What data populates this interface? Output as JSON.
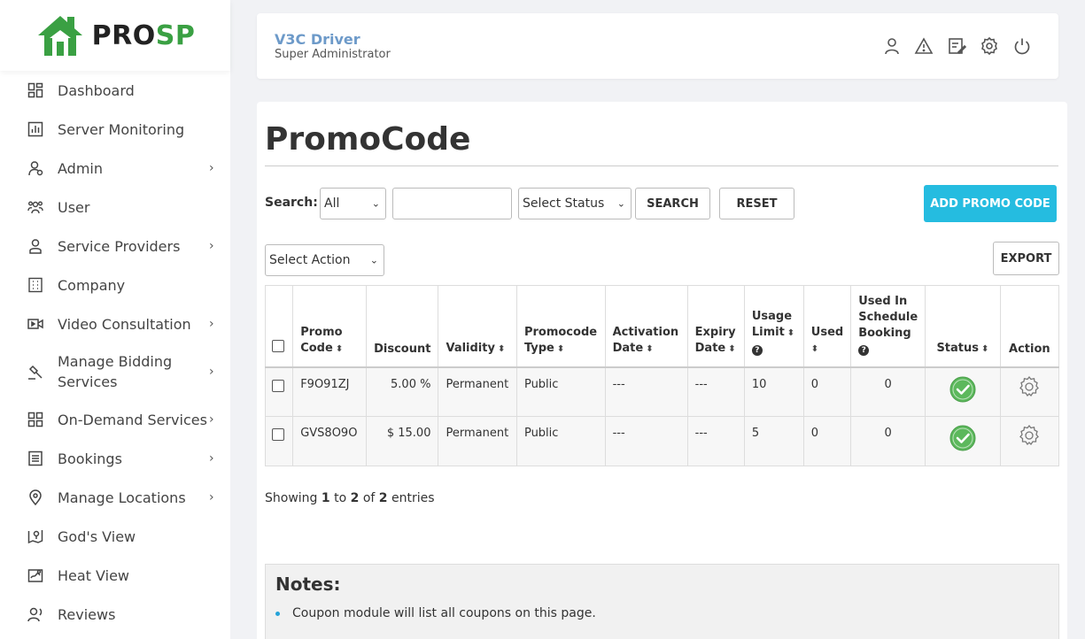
{
  "brand": {
    "logo_pro": "PRO",
    "logo_sp": "SP"
  },
  "sidebar": {
    "items": [
      {
        "label": "Dashboard",
        "icon": "dashboard-icon",
        "has_submenu": false
      },
      {
        "label": "Server Monitoring",
        "icon": "chart-icon",
        "has_submenu": false
      },
      {
        "label": "Admin",
        "icon": "admin-icon",
        "has_submenu": true
      },
      {
        "label": "User",
        "icon": "users-icon",
        "has_submenu": false
      },
      {
        "label": "Service Providers",
        "icon": "provider-icon",
        "has_submenu": true
      },
      {
        "label": "Company",
        "icon": "building-icon",
        "has_submenu": false
      },
      {
        "label": "Video Consultation",
        "icon": "video-icon",
        "has_submenu": true
      },
      {
        "label": "Manage Bidding Services",
        "icon": "gavel-icon",
        "has_submenu": true
      },
      {
        "label": "On-Demand Services",
        "icon": "grid-icon",
        "has_submenu": true
      },
      {
        "label": "Bookings",
        "icon": "list-icon",
        "has_submenu": true
      },
      {
        "label": "Manage Locations",
        "icon": "location-icon",
        "has_submenu": true
      },
      {
        "label": "God's View",
        "icon": "map-icon",
        "has_submenu": false
      },
      {
        "label": "Heat View",
        "icon": "heatmap-icon",
        "has_submenu": false
      },
      {
        "label": "Reviews",
        "icon": "review-icon",
        "has_submenu": false
      }
    ]
  },
  "header": {
    "user_name": "V3C Driver",
    "user_role": "Super Administrator",
    "icons": [
      "profile-icon",
      "alert-icon",
      "edit-note-icon",
      "settings-icon",
      "power-icon"
    ]
  },
  "page": {
    "title": "PromoCode",
    "search_label": "Search:",
    "search_field_select": "All",
    "search_input_value": "",
    "status_select": "Select Status",
    "search_button": "SEARCH",
    "reset_button": "RESET",
    "add_button": "ADD PROMO CODE",
    "action_select": "Select Action",
    "export_button": "EXPORT"
  },
  "table": {
    "columns": {
      "promo_code_1": "Promo",
      "promo_code_2": "Code",
      "discount": "Discount",
      "validity": "Validity",
      "type_1": "Promocode",
      "type_2": "Type",
      "activation_1": "Activation",
      "activation_2": "Date",
      "expiry_1": "Expiry",
      "expiry_2": "Date",
      "usage_1": "Usage",
      "usage_2": "Limit",
      "used": "Used",
      "schedule_1": "Used In",
      "schedule_2": "Schedule",
      "schedule_3": "Booking",
      "status": "Status",
      "action": "Action"
    },
    "rows": [
      {
        "code": "F9O91ZJ",
        "discount": "5.00 %",
        "validity": "Permanent",
        "type": "Public",
        "activation": "---",
        "expiry": "---",
        "usage_limit": "10",
        "used": "0",
        "schedule_used": "0",
        "status": "active"
      },
      {
        "code": "GVS8O9O",
        "discount": "$ 15.00",
        "validity": "Permanent",
        "type": "Public",
        "activation": "---",
        "expiry": "---",
        "usage_limit": "5",
        "used": "0",
        "schedule_used": "0",
        "status": "active"
      }
    ]
  },
  "showing": {
    "prefix": "Showing",
    "from": "1",
    "to_word": "to",
    "to": "2",
    "of_word": "of",
    "total": "2",
    "suffix": "entries"
  },
  "notes": {
    "title": "Notes:",
    "items": [
      "Coupon module will list all coupons on this page."
    ]
  },
  "colors": {
    "accent": "#25bce0",
    "brand_green": "#3aa043",
    "status_green": "#5cb85c",
    "user_name": "#6d9ac9"
  }
}
